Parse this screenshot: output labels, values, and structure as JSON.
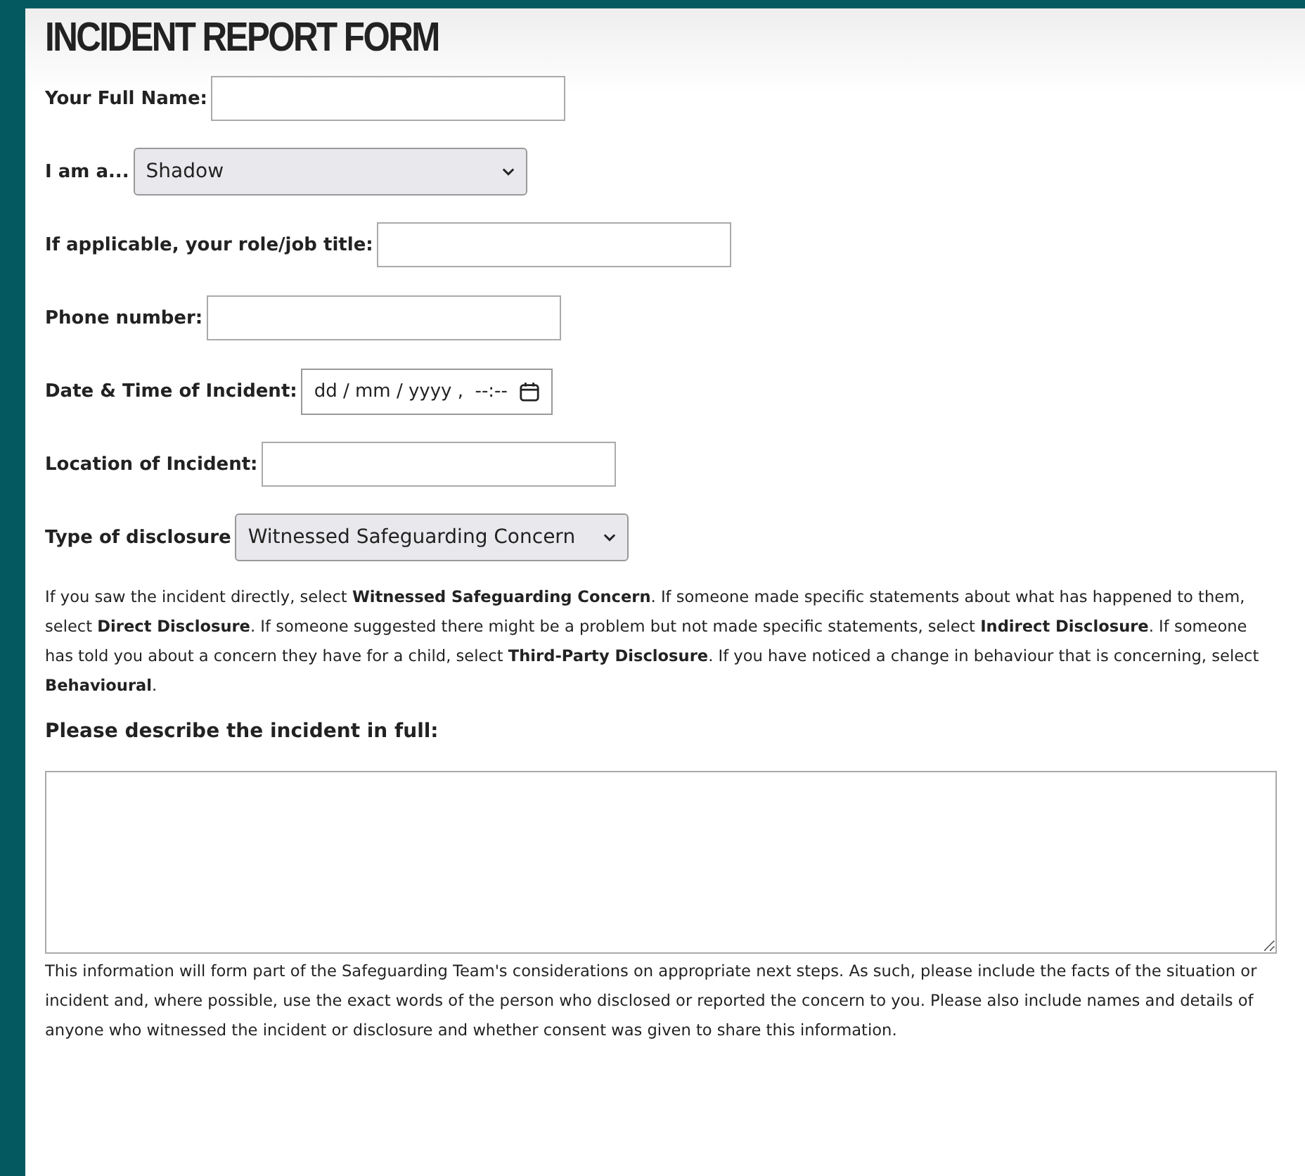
{
  "title": "INCIDENT REPORT FORM",
  "fields": [
    {
      "kind": "text",
      "label": "Your Full Name:"
    },
    {
      "kind": "select",
      "label": "I am a...",
      "value": "Shadow"
    },
    {
      "kind": "text",
      "label": "If applicable, your role/job title:"
    },
    {
      "kind": "text",
      "label": "Phone number:"
    },
    {
      "kind": "datetime",
      "label": "Date & Time of Incident:",
      "placeholder": "dd / mm / yyyy ,  --:--"
    },
    {
      "kind": "text",
      "label": "Location of Incident:"
    },
    {
      "kind": "select",
      "label": "Type of disclosure",
      "value": "Witnessed Safeguarding Concern"
    }
  ],
  "disclosure_help": "If you saw the incident directly, select **Witnessed Safeguarding Concern**. If someone made specific statements about what has happened to them, select **Direct Disclosure**. If someone suggested there might be a problem but not made specific statements, select **Indirect Disclosure**. If someone has told you about a concern they have for a child, select **Third-Party Disclosure**. If you have noticed a change in behaviour that is concerning, select **Behavioural**.",
  "description": {
    "label": "Please describe the incident in full:",
    "help": "This information will form part of the Safeguarding Team's considerations on appropriate next steps. As such, please include the facts of the situation or incident and, where possible, use the exact words of the person who disclosed or reported the concern to you. Please also include names and details of anyone who witnessed the incident or disclosure and whether consent was given to share this information."
  }
}
